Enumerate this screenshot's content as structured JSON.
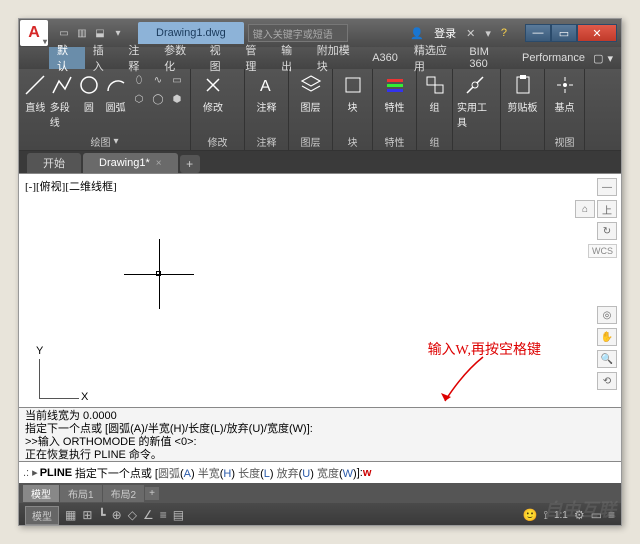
{
  "title": "Drawing1.dwg",
  "search_placeholder": "键入关键字或短语",
  "login": "登录",
  "menus": [
    "默认",
    "插入",
    "注释",
    "参数化",
    "视图",
    "管理",
    "输出",
    "附加模块",
    "A360",
    "精选应用",
    "BIM 360",
    "Performance"
  ],
  "ribbon": {
    "p1": {
      "btns": [
        "直线",
        "多段线",
        "圆",
        "圆弧"
      ],
      "title": "绘图"
    },
    "p2": {
      "btn": "修改",
      "title": "修改"
    },
    "p3": {
      "btn": "注释",
      "title": "注释"
    },
    "p4": {
      "btn": "图层",
      "title": "图层"
    },
    "p5": {
      "btn": "块",
      "title": "块"
    },
    "p6": {
      "btn": "特性",
      "title": "特性"
    },
    "p7": {
      "btn": "组",
      "title": "组"
    },
    "p8": {
      "btn": "实用工具",
      "title": ""
    },
    "p9": {
      "btn": "剪贴板",
      "title": ""
    },
    "p10": {
      "btn": "基点",
      "title": "视图"
    }
  },
  "doctabs": {
    "start": "开始",
    "active": "Drawing1*"
  },
  "viewport_label": "[-][俯视][二维线框]",
  "ucs": {
    "x": "X",
    "y": "Y"
  },
  "wcs": "WCS",
  "annotation": "输入W,再按空格键",
  "cmd_history": [
    "当前线宽为  0.0000",
    "指定下一个点或 [圆弧(A)/半宽(H)/长度(L)/放弃(U)/宽度(W)]:",
    ">>输入 ORTHOMODE 的新值 <0>:",
    "正在恢复执行 PLINE 命令。"
  ],
  "cmdline": {
    "prompt": ".: ▸",
    "cmd": "PLINE",
    "text": "指定下一个点或 [",
    "opts": [
      {
        "t": "圆弧",
        "k": "A"
      },
      {
        "t": "半宽",
        "k": "H"
      },
      {
        "t": "长度",
        "k": "L"
      },
      {
        "t": "放弃",
        "k": "U"
      },
      {
        "t": "宽度",
        "k": "W"
      }
    ],
    "tail": "]: ",
    "input": "w"
  },
  "layout_tabs": [
    "模型",
    "布局1",
    "布局2"
  ],
  "status_model": "模型",
  "status_scale": "1:1",
  "watermark": "自由互联"
}
